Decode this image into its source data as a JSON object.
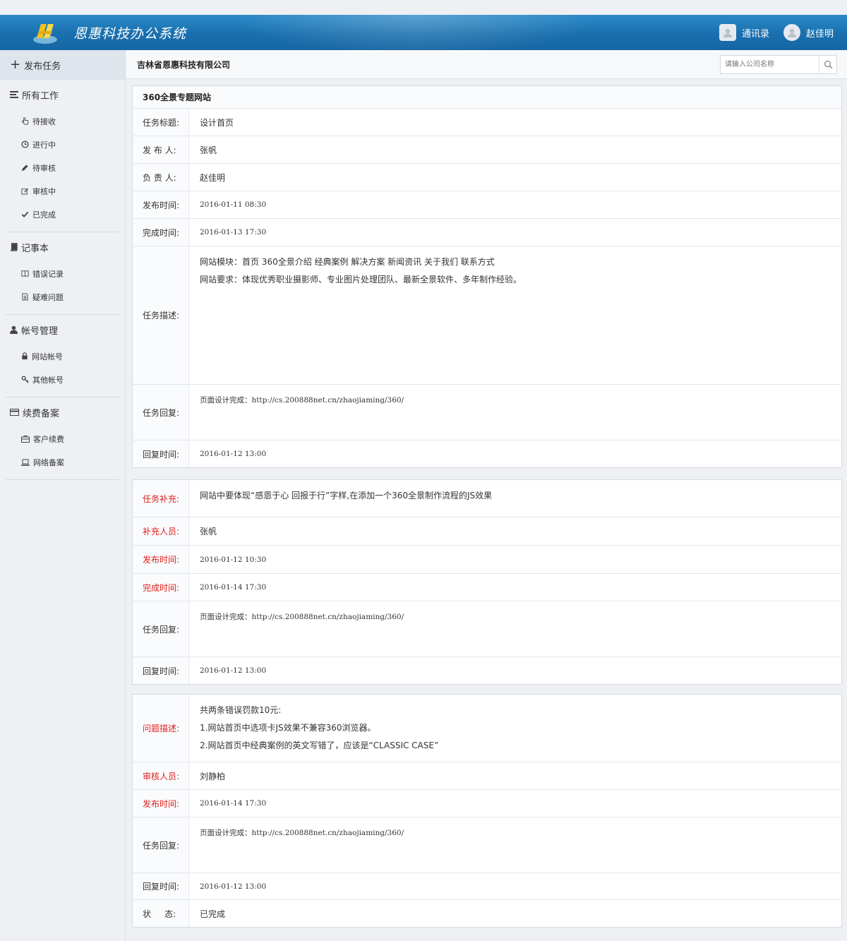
{
  "header": {
    "app_title": "恩惠科技办公系统",
    "contacts_label": "通讯录",
    "user_name": "赵佳明",
    "logo_icon": "company-logo"
  },
  "sidebar": {
    "publish_label": "发布任务",
    "groups": [
      {
        "label": "所有工作",
        "icon": "list-icon",
        "items": [
          {
            "label": "待接收",
            "icon": "hand-pointer-icon"
          },
          {
            "label": "进行中",
            "icon": "clock-icon"
          },
          {
            "label": "待审核",
            "icon": "pencil-icon"
          },
          {
            "label": "审核中",
            "icon": "edit-icon"
          },
          {
            "label": "已完成",
            "icon": "check-icon"
          }
        ]
      },
      {
        "label": "记事本",
        "icon": "book-icon",
        "items": [
          {
            "label": "错误记录",
            "icon": "columns-icon"
          },
          {
            "label": "疑难问题",
            "icon": "document-icon"
          }
        ]
      },
      {
        "label": "帐号管理",
        "icon": "user-icon",
        "items": [
          {
            "label": "网站帐号",
            "icon": "lock-icon"
          },
          {
            "label": "其他帐号",
            "icon": "key-icon"
          }
        ]
      },
      {
        "label": "续费备案",
        "icon": "credit-card-icon",
        "items": [
          {
            "label": "客户续费",
            "icon": "briefcase-icon"
          },
          {
            "label": "网络备案",
            "icon": "laptop-icon"
          }
        ]
      }
    ]
  },
  "main": {
    "company": "吉林省恩惠科技有限公司",
    "search_placeholder": "请输入公司名称",
    "task": {
      "heading": "360全景专题网站",
      "rows": [
        {
          "label": "任务标题:",
          "value": "设计首页"
        },
        {
          "label": "发 布 人:",
          "value": "张帆"
        },
        {
          "label": "负 责 人:",
          "value": "赵佳明"
        },
        {
          "label": "发布时间:",
          "value": "2016-01-11 08:30"
        },
        {
          "label": "完成时间:",
          "value": "2016-01-13 17:30"
        }
      ],
      "desc_label": "任务描述:",
      "desc_lines": [
        "网站模块：首页   360全景介绍   经典案例   解决方案   新闻资讯   关于我们   联系方式",
        "网站要求：体现优秀职业摄影师、专业图片处理团队、最新全景软件、多年制作经验。"
      ],
      "reply_label": "任务回复:",
      "reply_value": "页面设计完成：http://cs.200888net.cn/zhaojiaming/360/",
      "reply_time_label": "回复时间:",
      "reply_time": "2016-01-12 13:00"
    },
    "supplement": {
      "note_label": "任务补充:",
      "note_value": "网站中要体现“感恩于心 回报于行”字样,在添加一个360全景制作流程的JS效果",
      "person_label": "补充人员:",
      "person_value": "张帆",
      "publish_label": "发布时间:",
      "publish_value": "2016-01-12 10:30",
      "finish_label": "完成时间:",
      "finish_value": "2016-01-14 17:30",
      "reply_label": "任务回复:",
      "reply_value": "页面设计完成：http://cs.200888net.cn/zhaojiaming/360/",
      "reply_time_label": "回复时间:",
      "reply_time": "2016-01-12 13:00"
    },
    "review": {
      "issue_label": "问题描述:",
      "issue_lines": [
        "共两条错误罚款10元:",
        "1.网站首页中选项卡JS效果不兼容360浏览器。",
        "2.网站首页中经典案例的英文写错了，应该是“CLASSIC CASE”"
      ],
      "reviewer_label": "审核人员:",
      "reviewer_value": "刘静柏",
      "publish_label": "发布时间:",
      "publish_value": "2016-01-14 17:30",
      "reply_label": "任务回复:",
      "reply_value": "页面设计完成：http://cs.200888net.cn/zhaojiaming/360/",
      "reply_time_label": "回复时间:",
      "reply_time": "2016-01-12 13:00",
      "status_label": "状     态:",
      "status_value": "已完成"
    }
  },
  "colors": {
    "header_blue": "#1a6fae",
    "alert_red": "#e02020"
  }
}
